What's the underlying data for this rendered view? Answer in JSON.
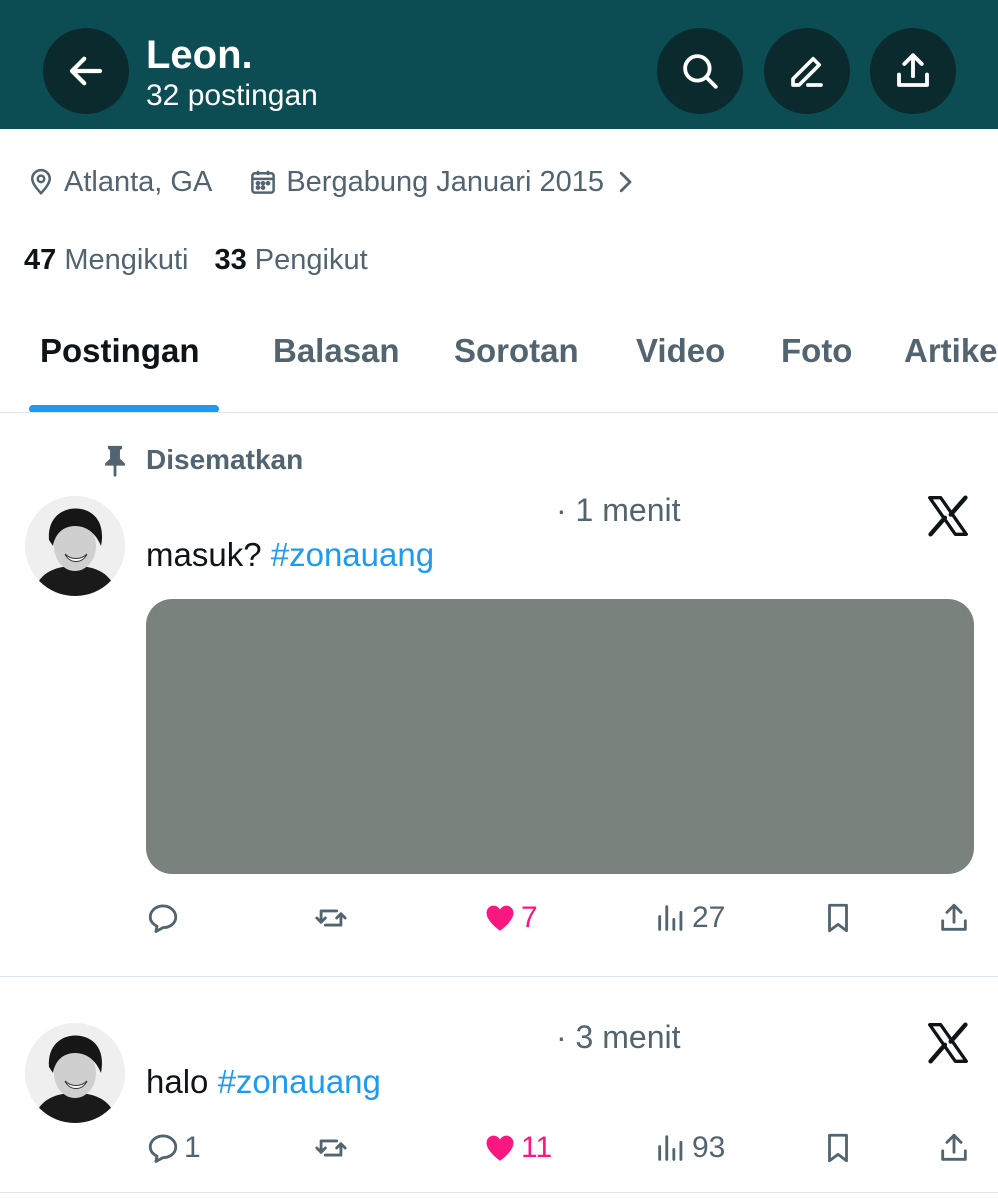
{
  "header": {
    "name": "Leon.",
    "post_count": "32 postingan"
  },
  "profile": {
    "location": "Atlanta, GA",
    "joined": "Bergabung Januari 2015",
    "following_count": "47",
    "following_label": "Mengikuti",
    "followers_count": "33",
    "followers_label": "Pengikut"
  },
  "tabs": [
    {
      "label": "Postingan",
      "active": true
    },
    {
      "label": "Balasan"
    },
    {
      "label": "Sorotan"
    },
    {
      "label": "Video"
    },
    {
      "label": "Foto"
    },
    {
      "label": "Artikel"
    }
  ],
  "pinned_label": "Disematkan",
  "posts": [
    {
      "time": "· 1 menit",
      "text": "masuk?",
      "hashtag": "#zonauang",
      "has_media": true,
      "replies": "",
      "reposts": "",
      "likes": "7",
      "views": "27"
    },
    {
      "time": "· 3 menit",
      "text": "halo",
      "hashtag": "#zonauang",
      "has_media": false,
      "replies": "1",
      "reposts": "",
      "likes": "11",
      "views": "93"
    }
  ],
  "colors": {
    "header_bg": "#0c4c53",
    "header_button_bg": "#0a2a2e",
    "accent_blue": "#1d9bf0",
    "like_pink": "#f91880",
    "media_placeholder": "#7a827e"
  },
  "icons": {
    "back": "arrow-left-icon",
    "search": "search-icon",
    "edit": "edit-pencil-icon",
    "share": "share-upload-icon",
    "location": "location-pin-icon",
    "calendar": "calendar-icon",
    "pinned": "pin-icon",
    "brand": "x-logo-icon"
  }
}
